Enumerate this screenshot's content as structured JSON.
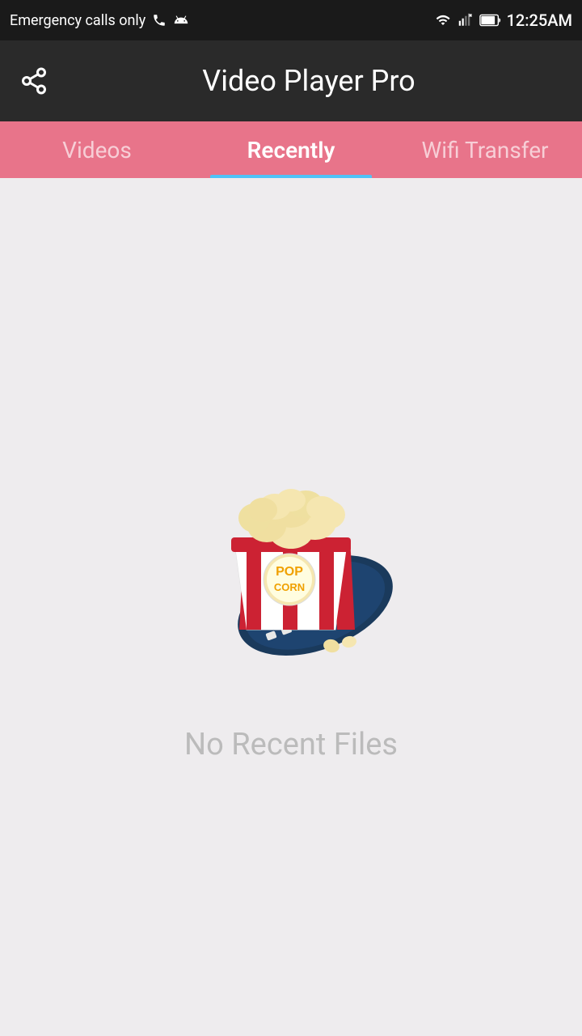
{
  "status_bar": {
    "left_text": "Emergency calls only",
    "time": "12:25AM",
    "icons": {
      "wifi": "wifi-icon",
      "signal": "signal-icon",
      "battery": "battery-icon"
    }
  },
  "app_bar": {
    "title": "Video Player Pro",
    "share_icon": "share-icon"
  },
  "tabs": [
    {
      "id": "videos",
      "label": "Videos",
      "active": false
    },
    {
      "id": "recently",
      "label": "Recently",
      "active": true
    },
    {
      "id": "wifi_transfer",
      "label": "Wifi Transfer",
      "active": false
    }
  ],
  "main": {
    "empty_state_text": "No Recent Files",
    "illustration_alt": "popcorn with film reel"
  }
}
